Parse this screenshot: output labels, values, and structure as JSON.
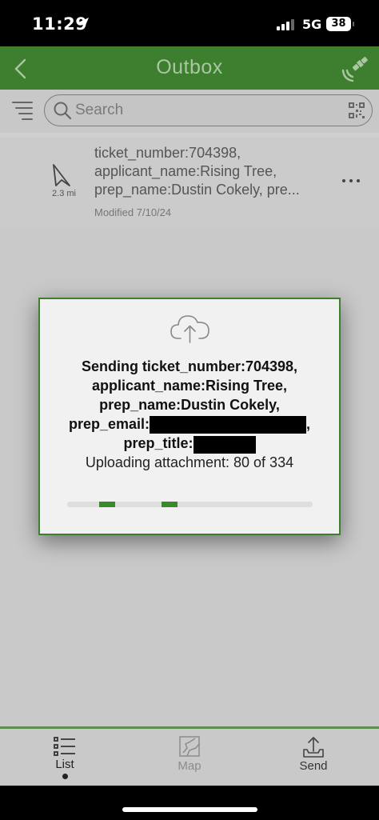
{
  "status_bar": {
    "time": "11:29",
    "network": "5G",
    "battery": "38"
  },
  "header": {
    "title": "Outbox"
  },
  "search": {
    "placeholder": "Search"
  },
  "outbox_item": {
    "line1": "ticket_number:704398,",
    "line2": "applicant_name:Rising Tree,",
    "line3": "prep_name:Dustin Cokely, pre...",
    "distance": "2.3 mi",
    "modified": "Modified 7/10/24"
  },
  "dialog": {
    "line1": "Sending ticket_number:704398,",
    "line2": "applicant_name:Rising Tree,",
    "line3": "prep_name:Dustin Cokely,",
    "line4_label": "prep_email:",
    "line4_suffix": ",",
    "line5_label": "prep_title:",
    "progress_text": "Uploading attachment: 80 of 334",
    "progress_fraction": 0.24
  },
  "tabs": {
    "list": "List",
    "map": "Map",
    "send": "Send"
  },
  "colors": {
    "brand_green": "#3e7e2f",
    "progress_green": "#3a8a2c"
  }
}
